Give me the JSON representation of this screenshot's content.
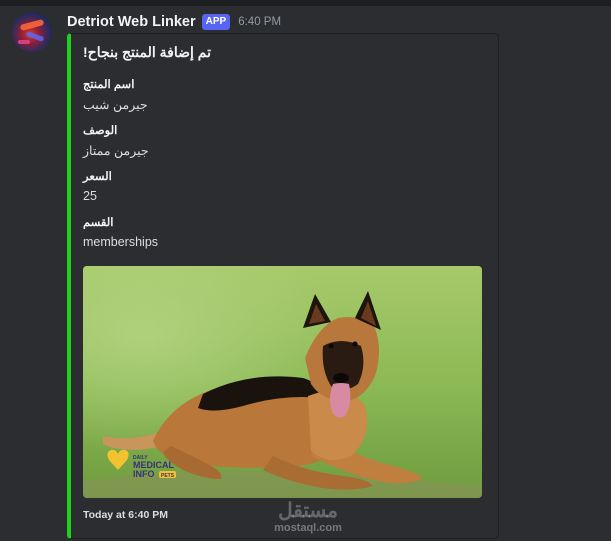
{
  "message": {
    "username": "Detriot Web Linker",
    "badge": "APP",
    "timestamp": "6:40 PM"
  },
  "embed": {
    "accent_color": "#1ed21e",
    "title": "تم إضافة المنتج بنجاح!",
    "fields": [
      {
        "name": "اسم المنتج",
        "value": "جيرمن شيب"
      },
      {
        "name": "الوصف",
        "value": "جيرمن ممتاز"
      },
      {
        "name": "السعر",
        "value": "25"
      },
      {
        "name": "القسم",
        "value": "memberships"
      }
    ],
    "image_logo": {
      "line1": "DAILY",
      "line2": "MEDICAL",
      "line3": "INFO",
      "tag": "PETS"
    },
    "footer": "Today at 6:40 PM"
  },
  "watermark": {
    "text": "مستقل",
    "sub": "mostaql.com"
  }
}
